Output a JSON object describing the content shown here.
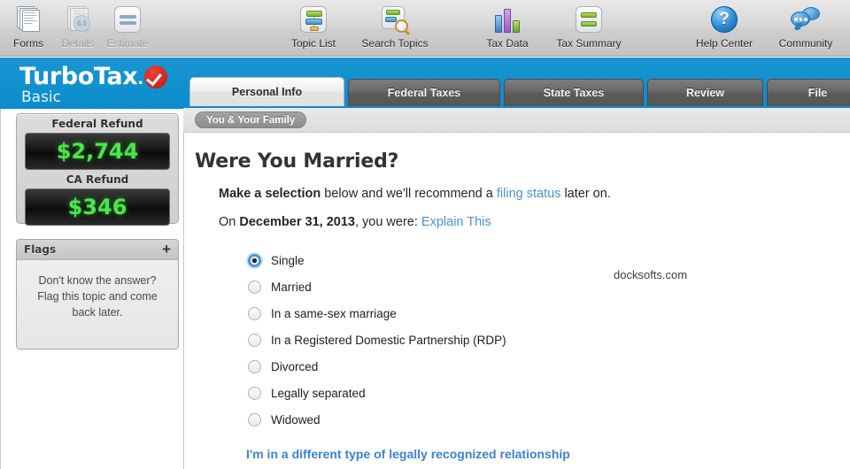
{
  "toolbar": {
    "left_items": [
      {
        "label": "Forms",
        "icon": "document-stack-icon",
        "disabled": false
      },
      {
        "label": "Details",
        "icon": "document-detail-icon",
        "disabled": true
      },
      {
        "label": "Estimate",
        "icon": "estimate-waves-icon",
        "disabled": true
      }
    ],
    "center_items": [
      {
        "label": "Topic List",
        "icon": "topic-list-icon"
      },
      {
        "label": "Search Topics",
        "icon": "search-topics-icon"
      },
      {
        "label": "Tax Data",
        "icon": "bar-chart-icon"
      },
      {
        "label": "Tax Summary",
        "icon": "summary-lines-icon"
      }
    ],
    "right_items": [
      {
        "label": "Help Center",
        "icon": "question-mark-icon"
      },
      {
        "label": "Community",
        "icon": "speech-bubbles-icon"
      }
    ]
  },
  "brand": {
    "name": "TurboTax",
    "edition": "Basic",
    "band_color": "#0d8ccb",
    "check_color": "#c3170f"
  },
  "tabs": [
    {
      "label": "Personal Info",
      "active": true
    },
    {
      "label": "Federal Taxes",
      "active": false
    },
    {
      "label": "State Taxes",
      "active": false
    },
    {
      "label": "Review",
      "active": false
    },
    {
      "label": "File",
      "active": false
    }
  ],
  "breadcrumb": "You & Your Family",
  "sidebar": {
    "federal": {
      "title": "Federal Refund",
      "amount": "$2,744"
    },
    "state": {
      "title": "CA Refund",
      "amount": "$346"
    },
    "flags": {
      "title": "Flags",
      "add_label": "+",
      "body": "Don't know the answer? Flag this topic and come back later."
    },
    "lcd_color": "#4ee44e"
  },
  "main": {
    "heading": "Were You Married?",
    "lead_bold": "Make a selection",
    "lead_mid": " below and we'll recommend a ",
    "lead_link": "filing status",
    "lead_end": " later on.",
    "date_prefix": "On ",
    "date_bold": "December 31, 2013",
    "date_mid": ", you were: ",
    "date_link": "Explain This",
    "options": [
      {
        "label": "Single",
        "selected": true
      },
      {
        "label": "Married",
        "selected": false
      },
      {
        "label": "In a same-sex marriage",
        "selected": false
      },
      {
        "label": "In a Registered Domestic Partnership (RDP)",
        "selected": false
      },
      {
        "label": "Divorced",
        "selected": false
      },
      {
        "label": "Legally separated",
        "selected": false
      },
      {
        "label": "Widowed",
        "selected": false
      }
    ],
    "alt_link": "I'm in a different type of legally recognized relationship",
    "link_color": "#3b82d6"
  },
  "watermark": "docksofts.com"
}
